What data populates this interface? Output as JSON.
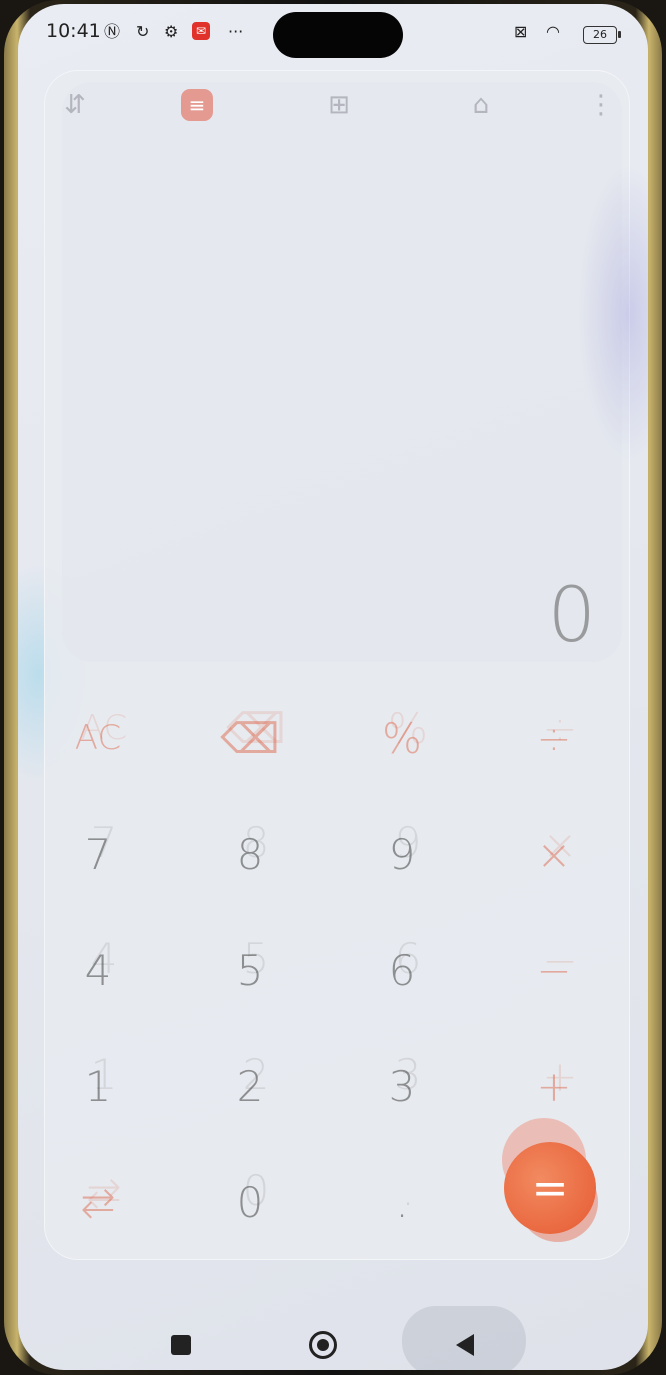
{
  "status_bar": {
    "time": "10:41",
    "icons": [
      "nfc-icon",
      "sync-icon",
      "settings-icon",
      "mail-icon",
      "more-dots-icon"
    ],
    "battery": "26"
  },
  "toolbar": {
    "items": [
      {
        "name": "unit-convert-icon",
        "glyph": "⇵"
      },
      {
        "name": "calculator-icon",
        "glyph": "≡"
      },
      {
        "name": "tools-grid-icon",
        "glyph": "⊞"
      },
      {
        "name": "mortgage-icon",
        "glyph": "⌂"
      },
      {
        "name": "more-menu-icon",
        "glyph": "⋮"
      }
    ]
  },
  "display": {
    "result": "0"
  },
  "keypad": {
    "rows": [
      [
        "AC",
        "⌫",
        "%",
        "÷"
      ],
      [
        "7",
        "8",
        "9",
        "×"
      ],
      [
        "4",
        "5",
        "6",
        "−"
      ],
      [
        "1",
        "2",
        "3",
        "+"
      ],
      [
        "⇄",
        "0",
        ".",
        "="
      ]
    ]
  },
  "colors": {
    "accent": "#e65a32",
    "background": "#e6e9ef"
  }
}
